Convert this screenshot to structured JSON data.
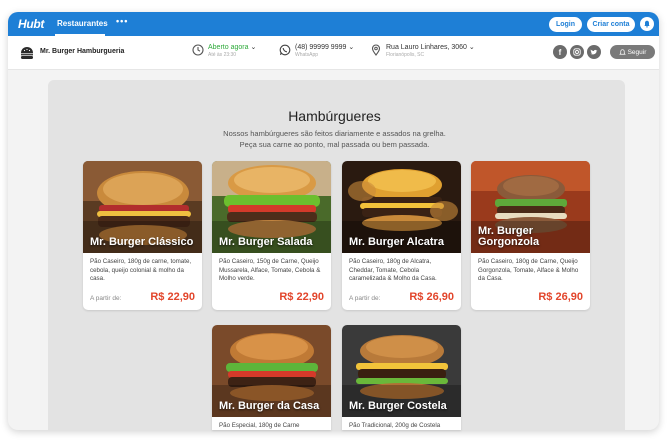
{
  "topbar": {
    "logo": "Hubt",
    "tab_restaurantes": "Restaurantes",
    "more": "•••",
    "login": "Login",
    "criar_conta": "Criar conta"
  },
  "infobar": {
    "brand_name": "Mr. Burger Hamburgueria",
    "hours": {
      "status": "Aberto agora",
      "sub": "Até às 23:30"
    },
    "phone": {
      "number": "(48) 99999 9999",
      "sub": "WhatsApp"
    },
    "address": {
      "street": "Rua Lauro Linhares, 3060",
      "city": "Florianópolis, SC"
    },
    "social": [
      "facebook",
      "instagram",
      "twitter"
    ],
    "follow": "Seguir"
  },
  "section": {
    "title": "Hambúrgueres",
    "desc_line1": "Nossos hambúrgueres são feitos diariamente e assados na grelha.",
    "desc_line2": "Peça sua carne ao ponto, mal passada ou bem passada."
  },
  "products": [
    {
      "name": "Mr. Burger Clássico",
      "desc": "Pão Caseiro, 180g de carne, tomate, cebola, queijo colonial & molho da casa.",
      "from_label": "A partir de:",
      "price": "R$ 22,90"
    },
    {
      "name": "Mr. Burger Salada",
      "desc": "Pão Caseiro, 150g de Carne, Queijo Mussarela, Alface, Tomate, Cebola & Molho verde.",
      "from_label": "",
      "price": "R$ 22,90"
    },
    {
      "name": "Mr. Burger Alcatra",
      "desc": "Pão Caseiro, 180g de Alcatra, Cheddar, Tomate, Cebola caramelizada & Molho da Casa.",
      "from_label": "A partir de:",
      "price": "R$ 26,90"
    },
    {
      "name": "Mr. Burger Gorgonzola",
      "desc": "Pão Caseiro, 180g de Carne, Queijo Gorgonzola, Tomate, Alface & Molho da Casa.",
      "from_label": "",
      "price": "R$ 26,90"
    },
    {
      "name": "Mr. Burger da Casa",
      "desc": "Pão Especial, 180g de Carne",
      "from_label": "",
      "price": ""
    },
    {
      "name": "Mr. Burger Costela",
      "desc": "Pão Tradicional, 200g de Costela",
      "from_label": "",
      "price": ""
    }
  ],
  "colors": {
    "primary": "#1e7fd6",
    "price": "#e2452b",
    "open": "#2eaa3a"
  }
}
